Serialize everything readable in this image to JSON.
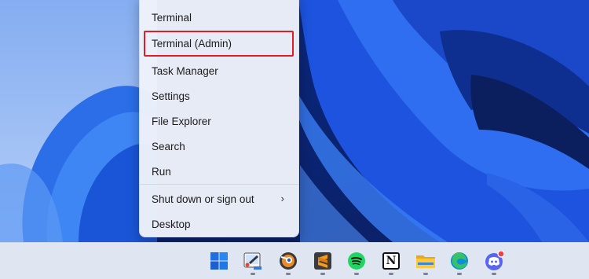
{
  "menu": {
    "items": [
      {
        "label": "Terminal"
      },
      {
        "label": "Terminal (Admin)",
        "highlighted": true
      },
      {
        "label": "Task Manager"
      },
      {
        "label": "Settings"
      },
      {
        "label": "File Explorer"
      },
      {
        "label": "Search"
      },
      {
        "label": "Run"
      },
      {
        "label": "Shut down or sign out",
        "submenu": true
      },
      {
        "label": "Desktop"
      }
    ],
    "chevron": "›"
  },
  "taskbar": {
    "icons": [
      {
        "name": "windows-start-icon",
        "running": false
      },
      {
        "name": "paint-app-icon",
        "running": true
      },
      {
        "name": "blender-app-icon",
        "running": true
      },
      {
        "name": "sublime-text-icon",
        "running": true
      },
      {
        "name": "spotify-icon",
        "running": true
      },
      {
        "name": "notion-icon",
        "running": true
      },
      {
        "name": "file-explorer-icon",
        "running": true
      },
      {
        "name": "edge-browser-icon",
        "running": true
      },
      {
        "name": "discord-icon",
        "running": true,
        "badge": true
      }
    ],
    "notion_glyph": "N"
  },
  "colors": {
    "highlight_border": "#e01d24",
    "wallpaper_blue": "#1b4fd6"
  }
}
